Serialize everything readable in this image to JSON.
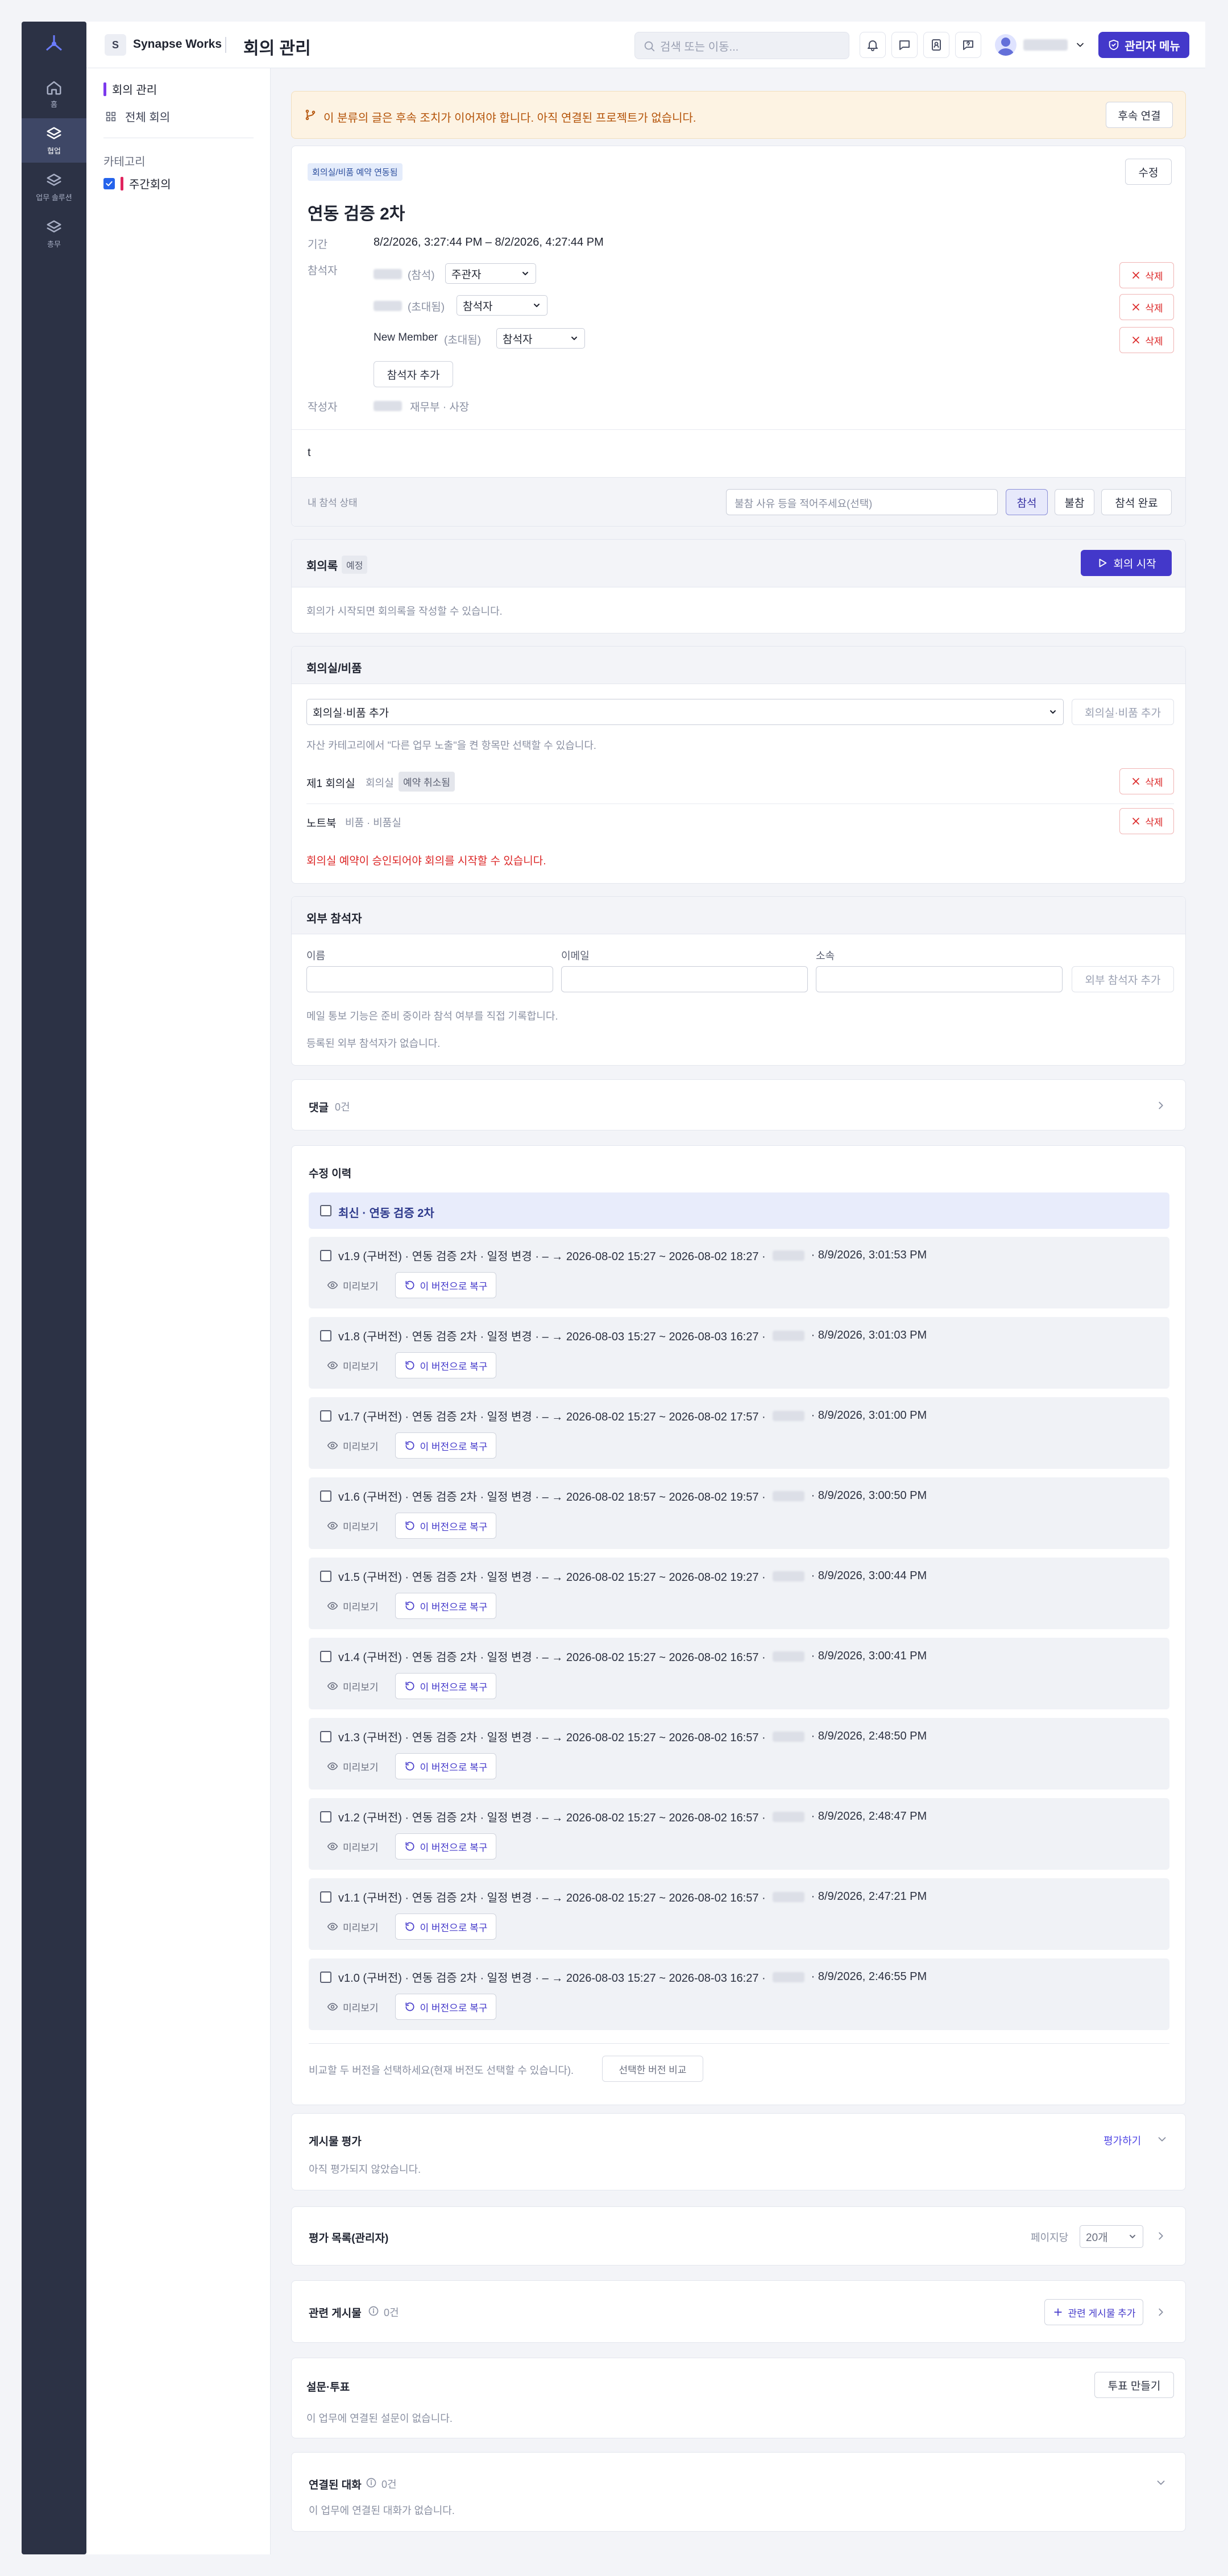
{
  "rail": {
    "items": [
      {
        "label": "홈",
        "icon": "home-icon"
      },
      {
        "label": "협업",
        "icon": "layers-icon"
      },
      {
        "label": "업무 솔루션",
        "icon": "layers-icon"
      },
      {
        "label": "총무",
        "icon": "layers-icon"
      }
    ],
    "active": "협업"
  },
  "header": {
    "workspace_badge": "S",
    "workspace_name": "Synapse Works",
    "title": "회의 관리",
    "search_placeholder": "검색 또는 이동...",
    "admin_button": "관리자 메뉴"
  },
  "subnav": {
    "top": "회의 관리",
    "all": "전체 회의",
    "category_label": "카테고리",
    "category_item": "주간회의"
  },
  "notice": {
    "text": "이 분류의 글은 후속 조치가 이어져야 합니다. 아직 연결된 프로젝트가 없습니다.",
    "button": "후속 연결"
  },
  "meeting": {
    "badge": "회의실/비품 예약 연동됨",
    "edit_button": "수정",
    "title": "연동 검증 2차",
    "period_label": "기간",
    "period_value": "8/2/2026, 3:27:44 PM – 8/2/2026, 4:27:44 PM",
    "attendees_label": "참석자",
    "attendees": [
      {
        "status": "(참석)",
        "role": "주관자"
      },
      {
        "status": "(초대됨)",
        "role": "참석자"
      },
      {
        "name": "New Member",
        "status": "(초대됨)",
        "role": "참석자"
      }
    ],
    "delete_label": "삭제",
    "add_attendee": "참석자 추가",
    "author_label": "작성자",
    "author_dept": "재무부 · 사장",
    "body": "t",
    "my_status_label": "내 참석 상태",
    "absence_placeholder": "불참 사유 등을 적어주세요(선택)",
    "status_buttons": [
      "참석",
      "불참",
      "참석 완료"
    ]
  },
  "minutes": {
    "title": "회의록",
    "tag": "예정",
    "start_button": "회의 시작",
    "hint": "회의가 시작되면 회의록을 작성할 수 있습니다."
  },
  "rooms": {
    "title": "회의실/비품",
    "select_value": "회의실·비품 추가",
    "add_button": "회의실·비품 추가",
    "hint": "자산 카테고리에서 \"다른 업무 노출\"을 켠 항목만 선택할 수 있습니다.",
    "items": [
      {
        "name": "제1 회의실",
        "type": "회의실",
        "tag": "예약 취소됨"
      },
      {
        "name": "노트북",
        "type": "비품 · 비품실"
      }
    ],
    "delete_label": "삭제",
    "warning": "회의실 예약이 승인되어야 회의를 시작할 수 있습니다."
  },
  "external": {
    "title": "외부 참석자",
    "fields": [
      "이름",
      "이메일",
      "소속"
    ],
    "add_button": "외부 참석자 추가",
    "hint1": "메일 통보 기능은 준비 중이라 참석 여부를 직접 기록합니다.",
    "hint2": "등록된 외부 참석자가 없습니다."
  },
  "comments": {
    "title": "댓글",
    "count": "0건"
  },
  "history": {
    "title": "수정 이력",
    "latest": "최신 · 연동 검증 2차",
    "preview_label": "미리보기",
    "restore_label": "이 버전으로 복구",
    "versions": [
      {
        "label": "v1.9 (구버전) · 연동 검증 2차 · 일정 변경 · – → 2026-08-02 15:27 ~ 2026-08-02 18:27 ·",
        "time": "· 8/9/2026, 3:01:53 PM"
      },
      {
        "label": "v1.8 (구버전) · 연동 검증 2차 · 일정 변경 · – → 2026-08-03 15:27 ~ 2026-08-03 16:27 ·",
        "time": "· 8/9/2026, 3:01:03 PM"
      },
      {
        "label": "v1.7 (구버전) · 연동 검증 2차 · 일정 변경 · – → 2026-08-02 15:27 ~ 2026-08-02 17:57 ·",
        "time": "· 8/9/2026, 3:01:00 PM"
      },
      {
        "label": "v1.6 (구버전) · 연동 검증 2차 · 일정 변경 · – → 2026-08-02 18:57 ~ 2026-08-02 19:57 ·",
        "time": "· 8/9/2026, 3:00:50 PM"
      },
      {
        "label": "v1.5 (구버전) · 연동 검증 2차 · 일정 변경 · – → 2026-08-02 15:27 ~ 2026-08-02 19:27 ·",
        "time": "· 8/9/2026, 3:00:44 PM"
      },
      {
        "label": "v1.4 (구버전) · 연동 검증 2차 · 일정 변경 · – → 2026-08-02 15:27 ~ 2026-08-02 16:57 ·",
        "time": "· 8/9/2026, 3:00:41 PM"
      },
      {
        "label": "v1.3 (구버전) · 연동 검증 2차 · 일정 변경 · – → 2026-08-02 15:27 ~ 2026-08-02 16:57 ·",
        "time": "· 8/9/2026, 2:48:50 PM"
      },
      {
        "label": "v1.2 (구버전) · 연동 검증 2차 · 일정 변경 · – → 2026-08-02 15:27 ~ 2026-08-02 16:57 ·",
        "time": "· 8/9/2026, 2:48:47 PM"
      },
      {
        "label": "v1.1 (구버전) · 연동 검증 2차 · 일정 변경 · – → 2026-08-02 15:27 ~ 2026-08-02 16:57 ·",
        "time": "· 8/9/2026, 2:47:21 PM"
      },
      {
        "label": "v1.0 (구버전) · 연동 검증 2차 · 일정 변경 · – → 2026-08-03 15:27 ~ 2026-08-03 16:27 ·",
        "time": "· 8/9/2026, 2:46:55 PM"
      }
    ],
    "compare_hint": "비교할 두 버전을 선택하세요(현재 버전도 선택할 수 있습니다).",
    "compare_button": "선택한 버전 비교"
  },
  "rating": {
    "title": "게시물 평가",
    "action": "평가하기",
    "empty": "아직 평가되지 않았습니다."
  },
  "rating_list": {
    "title": "평가 목록(관리자)",
    "per_page_label": "페이지당",
    "per_page_value": "20개"
  },
  "related": {
    "title": "관련 게시물",
    "count": "0건",
    "add_button": "관련 게시물 추가"
  },
  "survey": {
    "title": "설문·투표",
    "button": "투표 만들기",
    "empty": "이 업무에 연결된 설문이 없습니다."
  },
  "linked": {
    "title": "연결된 대화",
    "count": "0건",
    "empty": "이 업무에 연결된 대화가 없습니다."
  },
  "colors": {
    "accent": "#4338ca",
    "danger": "#dc2626",
    "sidebar": "#2c3245",
    "notice_bg": "#fdf3e3"
  }
}
